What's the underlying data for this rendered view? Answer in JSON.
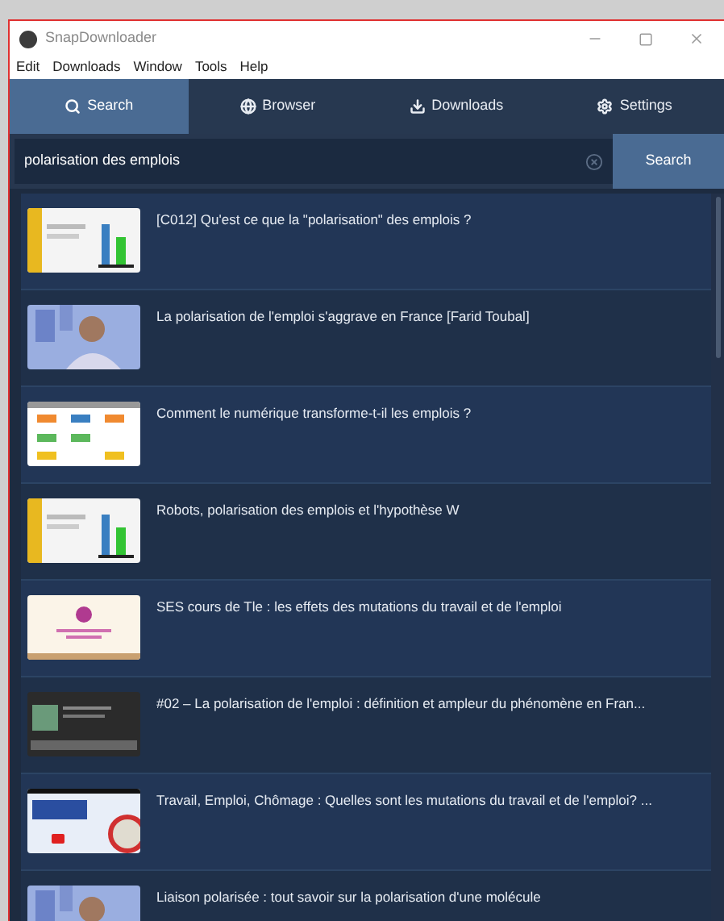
{
  "window": {
    "title": "SnapDownloader"
  },
  "menu": [
    "Edit",
    "Downloads",
    "Window",
    "Tools",
    "Help"
  ],
  "tabs": [
    {
      "label": "Search",
      "kind": "search",
      "selected": true
    },
    {
      "label": "Browser",
      "kind": "globe",
      "selected": false
    },
    {
      "label": "Downloads",
      "kind": "download",
      "selected": false
    },
    {
      "label": "Settings",
      "kind": "gear",
      "selected": false
    }
  ],
  "search": {
    "value": "polarisation des emplois",
    "button": "Search"
  },
  "results": [
    {
      "title": "[C012] Qu'est ce que la \"polarisation\" des emplois ?"
    },
    {
      "title": "La polarisation de l'emploi s'aggrave en France [Farid Toubal]"
    },
    {
      "title": "Comment le numérique transforme-t-il les emplois ?"
    },
    {
      "title": "Robots, polarisation des emplois et l'hypothèse W"
    },
    {
      "title": "SES cours de Tle : les effets des mutations du travail et de l'emploi"
    },
    {
      "title": "#02 – La polarisation de l'emploi : définition et ampleur du phénomène en Fran..."
    },
    {
      "title": "Travail, Emploi, Chômage : Quelles sont les mutations du travail et de l'emploi? ..."
    },
    {
      "title": "Liaison polarisée : tout savoir sur la polarisation d'une molécule"
    }
  ]
}
